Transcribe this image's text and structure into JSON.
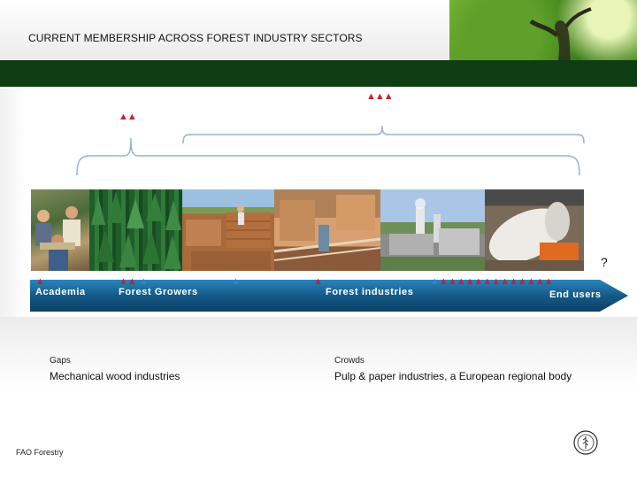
{
  "header": {
    "title": "CURRENT MEMBERSHIP ACROSS FOREST INDUSTRY SECTORS"
  },
  "timeline": {
    "sectors": [
      "Academia",
      "Forest Growers",
      "Forest industries",
      "End users"
    ],
    "question_mark": "?",
    "markers": {
      "academia_top": "▲▲",
      "forest_industries_top": "▲▲▲",
      "academia_band": "▲",
      "forest_growers_band": "▲▲",
      "forest_growers_band_blue": "▲",
      "mid_band_blue": "▲",
      "forest_industries_band": "▲",
      "pulp_band_blue": "▲",
      "end_users_band": "▲▲▲▲▲▲▲▲▲▲▲▲▲"
    },
    "colors": {
      "red_marker": "#cc2030",
      "blue_marker": "#2f86c8",
      "band": "#1b6f9e"
    }
  },
  "gaps": {
    "heading": "Gaps",
    "text": "Mechanical wood industries"
  },
  "crowds": {
    "heading": "Crowds",
    "text": "Pulp & paper industries, a European regional body"
  },
  "footer": {
    "source": "FAO Forestry"
  }
}
